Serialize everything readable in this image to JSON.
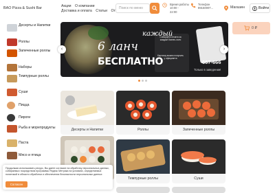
{
  "header": {
    "logo": "BAO Pizza & Sushi Bar",
    "nav_row1": [
      "Акции",
      "О компании"
    ],
    "nav_row2": [
      "Доставка и оплата",
      "Статьи",
      "Отзывы"
    ],
    "search_placeholder": "Поиск по меню",
    "hours_label": "Время работы",
    "hours_from": "10:00 -",
    "hours_to": "22:00",
    "phone_label": "Телефон",
    "phone_value": "89150007...",
    "shops_label": "Магазин",
    "login_label": "Войти"
  },
  "cart": {
    "total": "0 ₽"
  },
  "sidebar": {
    "items": [
      {
        "label": "Десерты и Напитки",
        "color": "#cfd3d8"
      },
      {
        "label": "Роллы",
        "color": "#c0392b"
      },
      {
        "label": "Запеченные роллы",
        "color": "#d35400"
      },
      {
        "label": "Наборы",
        "color": "#b3743a"
      },
      {
        "label": "Темпурные роллы",
        "color": "#c79a5b"
      },
      {
        "label": "Суши",
        "color": "#d05a30"
      },
      {
        "label": "Пицца",
        "color": "#e0a16a"
      },
      {
        "label": "Пироги",
        "color": "#3a3a3a"
      },
      {
        "label": "Рыба и морепродукты",
        "color": "#c4552d"
      },
      {
        "label": "Паста",
        "color": "#d9b26a"
      },
      {
        "label": "Мясо и птица",
        "color": "#8e5a3a"
      }
    ]
  },
  "banner": {
    "line1": "каждый",
    "line2": "6 ланч",
    "line3": "БЕСПЛАТНО",
    "card_text1": "Собирайте печати за каждый бизнес-ланч",
    "card_text2": "Карточку можно получить у официанта",
    "phone": "667-666",
    "note": "Только в заведении!"
  },
  "grid": [
    {
      "label": "Десерты и Напитки",
      "color": "#e9e4dc"
    },
    {
      "label": "Роллы",
      "color": "#2a2a2a"
    },
    {
      "label": "Запеченные роллы",
      "color": "#3b2b20"
    },
    {
      "label": "",
      "color": "#cfc6b8"
    },
    {
      "label": "Темпурные роллы",
      "color": "#2f3a45"
    },
    {
      "label": "Суши",
      "color": "#2b2b2b"
    }
  ],
  "cookie": {
    "text": "Продолжая использовать ресурс, Вы даете согласие на обработку персональных данных, собираемых посредством программы Яндекс Метрика на условиях, определяемых политикой в области обработки и обеспечения безопасности персональных данных",
    "button": "Согласен"
  }
}
